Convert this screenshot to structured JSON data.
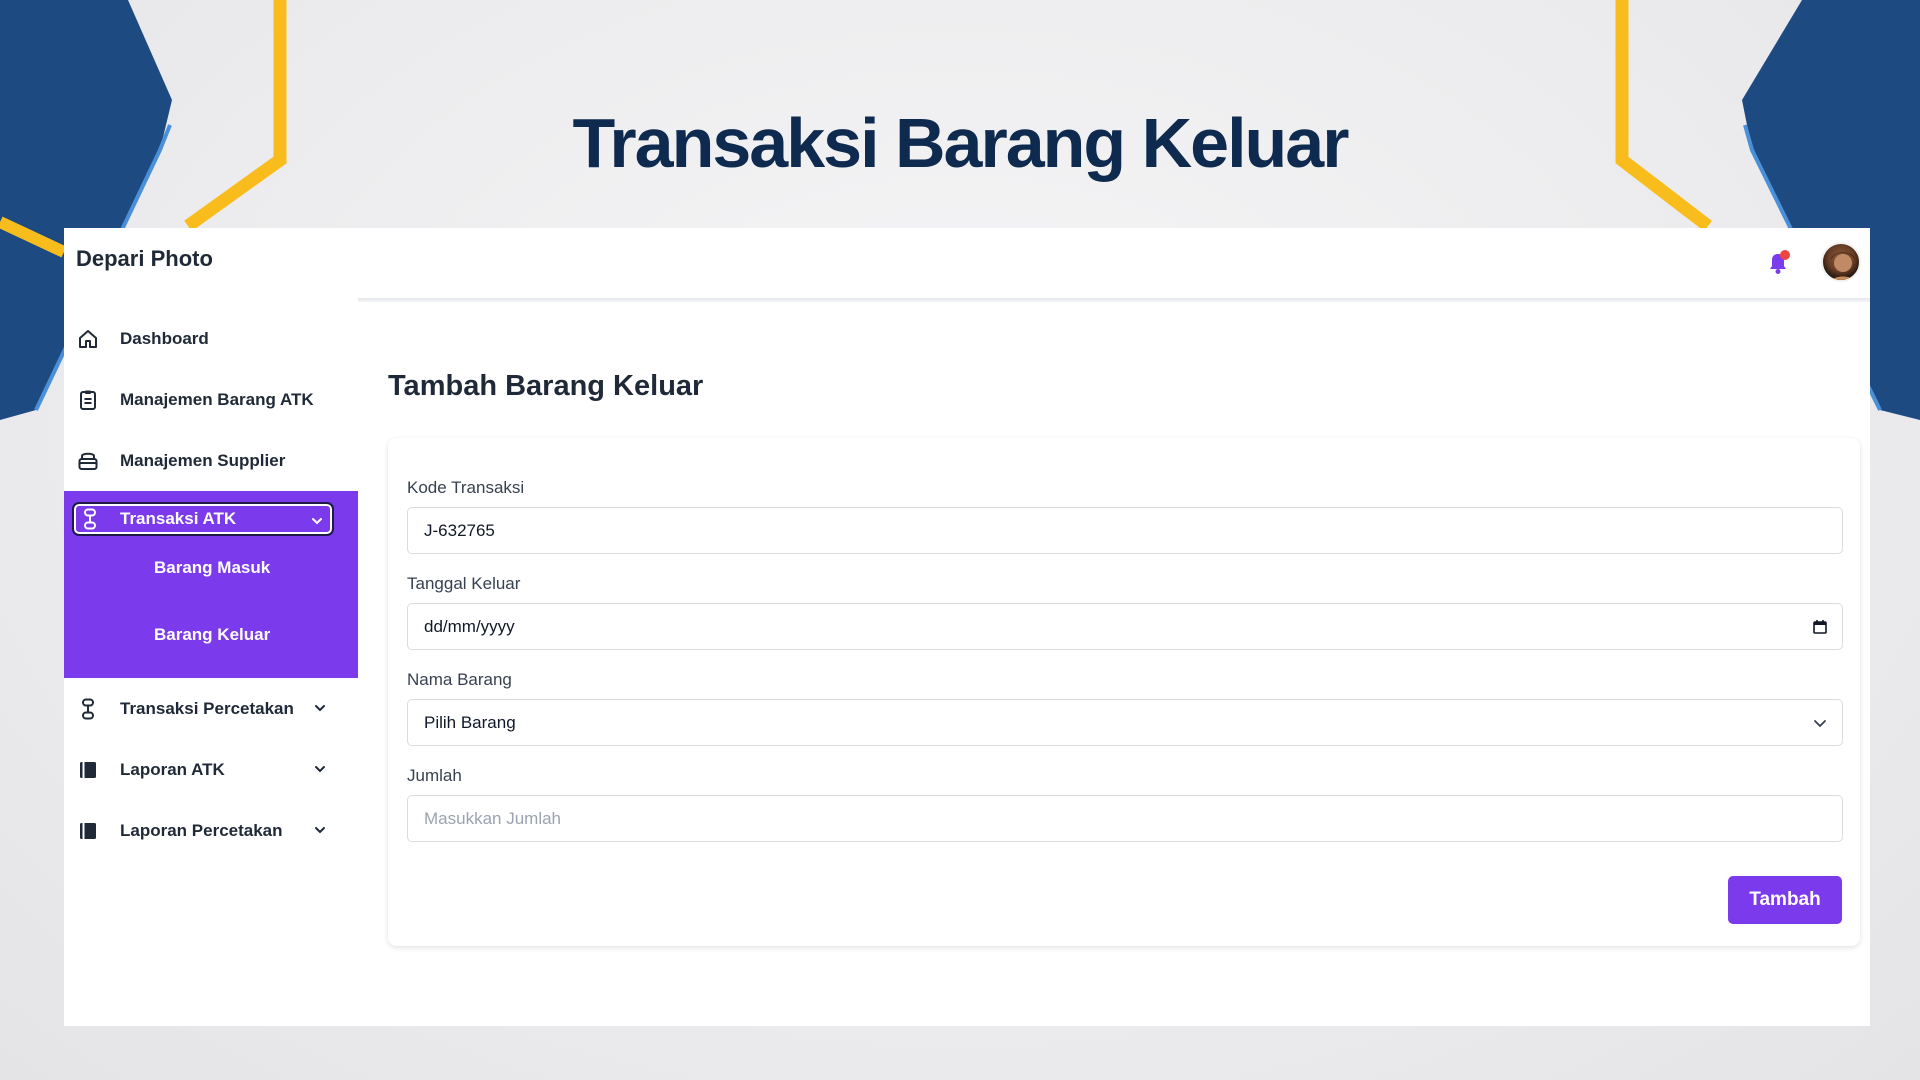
{
  "slide": {
    "title": "Transaksi Barang Keluar"
  },
  "app": {
    "brand": "Depari Photo"
  },
  "header": {
    "has_notification": true
  },
  "sidebar": {
    "items": [
      {
        "label": "Dashboard",
        "icon": "home-icon"
      },
      {
        "label": "Manajemen Barang ATK",
        "icon": "clipboard-icon"
      },
      {
        "label": "Manajemen Supplier",
        "icon": "box-icon"
      }
    ],
    "open_group": {
      "label": "Transaksi ATK",
      "icon": "transaction-icon",
      "children": [
        {
          "label": "Barang Masuk"
        },
        {
          "label": "Barang Keluar"
        }
      ]
    },
    "groups": [
      {
        "label": "Transaksi Percetakan",
        "icon": "transaction-icon"
      },
      {
        "label": "Laporan ATK",
        "icon": "book-icon"
      },
      {
        "label": "Laporan Percetakan",
        "icon": "book-icon"
      }
    ]
  },
  "main": {
    "heading": "Tambah Barang Keluar",
    "form": {
      "kode_label": "Kode Transaksi",
      "kode_value": "J-632765",
      "tanggal_label": "Tanggal Keluar",
      "tanggal_value": "dd/mm/yyyy",
      "barang_label": "Nama Barang",
      "barang_selected": "Pilih Barang",
      "jumlah_label": "Jumlah",
      "jumlah_placeholder": "Masukkan Jumlah",
      "submit_label": "Tambah"
    }
  },
  "colors": {
    "accent": "#7c3aed",
    "title": "#0f2a4f",
    "deco_blue": "#1e4a82",
    "deco_yellow": "#f8bd1c",
    "notification_dot": "#ef4444"
  }
}
